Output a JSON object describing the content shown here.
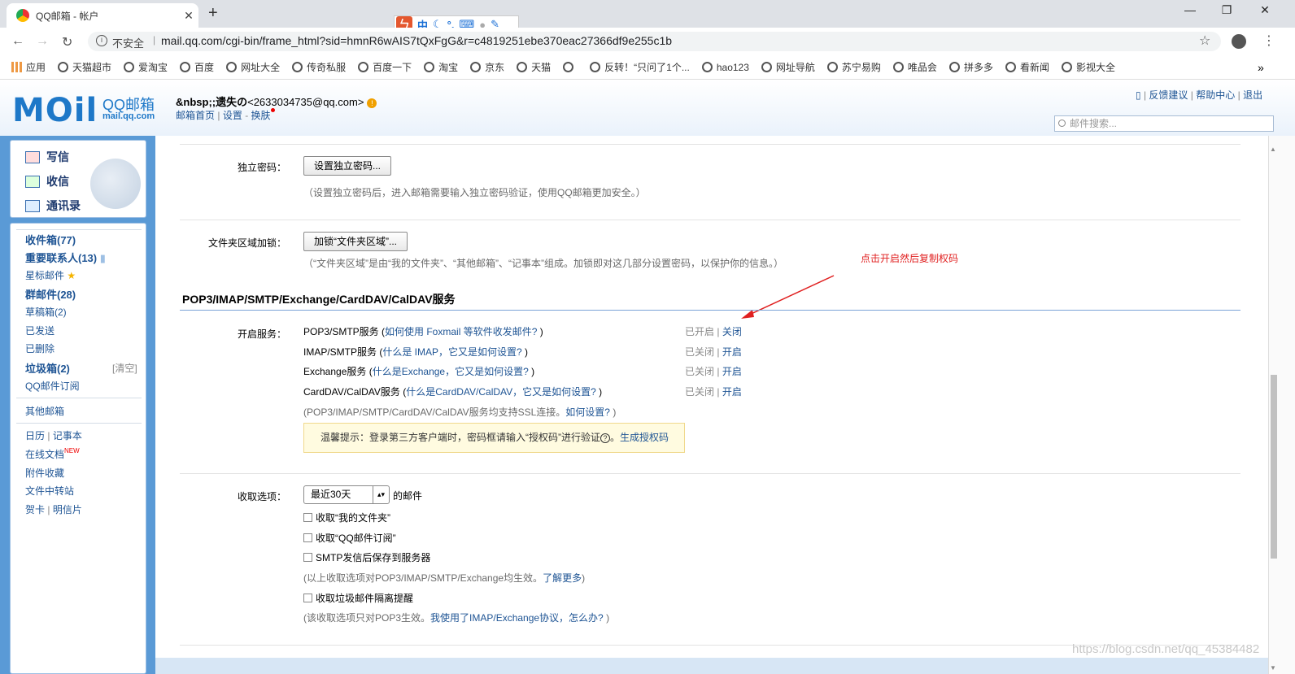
{
  "browser": {
    "tab_title": "QQ邮箱 - 帐户",
    "tab_close": "✕",
    "new_tab": "+",
    "not_secure": "不安全",
    "url": "mail.qq.com/cgi-bin/frame_html?sid=hmnR6wAIS7tQxFgG&r=c4819251ebe370eac27366df9e255c1b",
    "ime_char": "中",
    "bookmarks": [
      "应用",
      "天猫超市",
      "爱淘宝",
      "百度",
      "网址大全",
      "传奇私服",
      "百度一下",
      "淘宝",
      "京东",
      "天猫",
      "",
      "反转！“只问了1个...",
      "hao123",
      "网址导航",
      "苏宁易购",
      "唯品会",
      "拼多多",
      "看新闻",
      "影视大全"
    ],
    "bookmarks_more": "»"
  },
  "header": {
    "logo": "MOil",
    "logo_cn": "QQ邮箱",
    "logo_domain": "mail.qq.com",
    "user_name": "&nbsp;;遗失の",
    "user_email": "<2633034735@qq.com>",
    "home_link": "邮箱首页",
    "settings_link": "设置",
    "skin_link": "换肤",
    "top_links": [
      "反馈建议",
      "帮助中心",
      "退出"
    ],
    "search_placeholder": "邮件搜索..."
  },
  "sidebar": {
    "compose": "写信",
    "inbox_check": "收信",
    "contacts": "通讯录",
    "folders": [
      {
        "label": "收件箱(77)",
        "bold": true
      },
      {
        "label": "重要联系人(13)",
        "bold": true
      },
      {
        "label": "星标邮件",
        "bold": false
      },
      {
        "label": "群邮件(28)",
        "bold": true
      },
      {
        "label": "草稿箱(2)",
        "bold": false
      },
      {
        "label": "已发送",
        "bold": false
      },
      {
        "label": "已删除",
        "bold": false
      },
      {
        "label": "垃圾箱(2)",
        "bold": true
      },
      {
        "label": "QQ邮件订阅",
        "bold": false
      }
    ],
    "clear_label": "[清空]",
    "other_mail": "其他邮箱",
    "calendar": "日历",
    "notebook": "记事本",
    "online_docs": "在线文档",
    "new_badge": "NEW",
    "attachments": "附件收藏",
    "file_transfer": "文件中转站",
    "cards": "贺卡",
    "postcard": "明信片"
  },
  "settings": {
    "pwd_label": "独立密码：",
    "pwd_button": "设置独立密码...",
    "pwd_note": "（设置独立密码后，进入邮箱需要输入独立密码验证，使用QQ邮箱更加安全。）",
    "lock_label": "文件夹区域加锁：",
    "lock_button": "加锁“文件夹区域”...",
    "lock_note": "（“文件夹区域”是由“我的文件夹”、“其他邮箱”、“记事本”组成。加锁即对这几部分设置密码，以保护你的信息。）",
    "annotation": "点击开启然后复制权码",
    "section_title": "POP3/IMAP/SMTP/Exchange/CardDAV/CalDAV服务",
    "enable_label": "开启服务：",
    "services": [
      {
        "name": "POP3/SMTP服务 (",
        "help": "如何使用 Foxmail 等软件收发邮件?",
        "close": " )",
        "status": "已开启",
        "action": "关闭"
      },
      {
        "name": "IMAP/SMTP服务 (",
        "help": "什么是 IMAP，它又是如何设置?",
        "close": " )",
        "status": "已关闭",
        "action": "开启"
      },
      {
        "name": "Exchange服务 (",
        "help": "什么是Exchange，它又是如何设置?",
        "close": " )",
        "status": "已关闭",
        "action": "开启"
      },
      {
        "name": "CardDAV/CalDAV服务 (",
        "help": "什么是CardDAV/CalDAV，它又是如何设置?",
        "close": " )",
        "status": "已关闭",
        "action": "开启"
      }
    ],
    "ssl_note": "(POP3/IMAP/SMTP/CardDAV/CalDAV服务均支持SSL连接。",
    "ssl_link": "如何设置?",
    "ssl_close": " )",
    "tip_text": "温馨提示：登录第三方客户端时，密码框请输入“授权码”进行验证",
    "tip_q": "?",
    "tip_dot": "。",
    "tip_link": "生成授权码",
    "receive_label": "收取选项：",
    "receive_select": "最近30天",
    "receive_suffix": "的邮件",
    "cb1": "收取“我的文件夹”",
    "cb2": "收取“QQ邮件订阅”",
    "cb3": "SMTP发信后保存到服务器",
    "note3a": "(以上收取选项对POP3/IMAP/SMTP/Exchange均生效。",
    "note3b": "了解更多",
    "note3c": ")",
    "cb4": "收取垃圾邮件隔离提醒",
    "note4a": "(该收取选项只对POP3生效。",
    "note4b": "我使用了IMAP/Exchange协议，怎么办?",
    "note4c": " )"
  },
  "watermark": "https://blog.csdn.net/qq_45384482"
}
